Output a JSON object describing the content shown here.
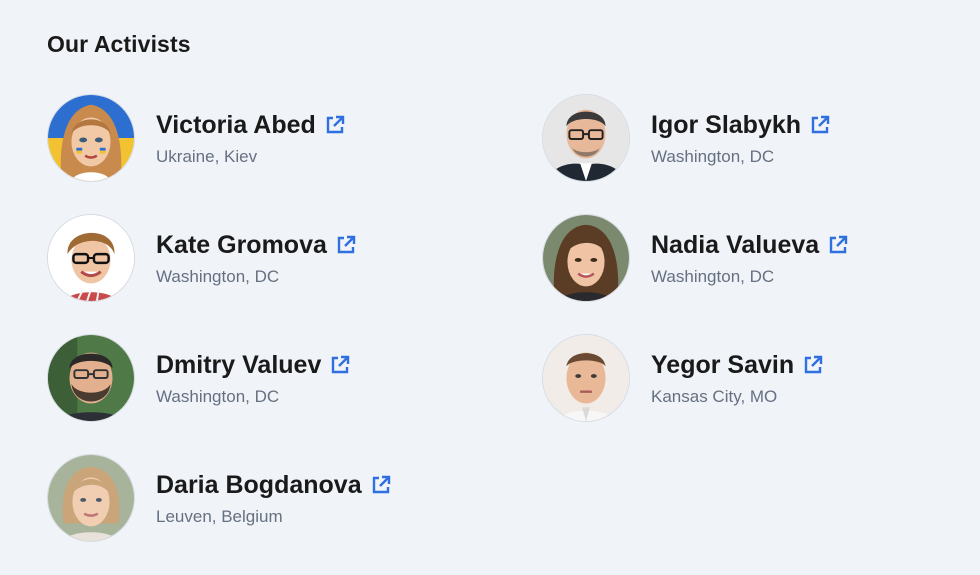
{
  "section": {
    "title": "Our Activists"
  },
  "colors": {
    "background": "#f0f3f8",
    "name_text": "#1a1a1a",
    "location_text": "#667081",
    "link_icon": "#2f6fe0"
  },
  "activists": [
    {
      "name": "Victoria Abed",
      "location": "Ukraine, Kiev",
      "link_icon": "external-link-icon"
    },
    {
      "name": "Igor Slabykh",
      "location": "Washington, DC",
      "link_icon": "external-link-icon"
    },
    {
      "name": "Kate Gromova",
      "location": "Washington, DC",
      "link_icon": "external-link-icon"
    },
    {
      "name": "Nadia Valueva",
      "location": "Washington, DC",
      "link_icon": "external-link-icon"
    },
    {
      "name": "Dmitry Valuev",
      "location": "Washington, DC",
      "link_icon": "external-link-icon"
    },
    {
      "name": "Yegor Savin",
      "location": "Kansas City, MO",
      "link_icon": "external-link-icon"
    },
    {
      "name": "Daria Bogdanova",
      "location": "Leuven, Belgium",
      "link_icon": "external-link-icon"
    }
  ]
}
